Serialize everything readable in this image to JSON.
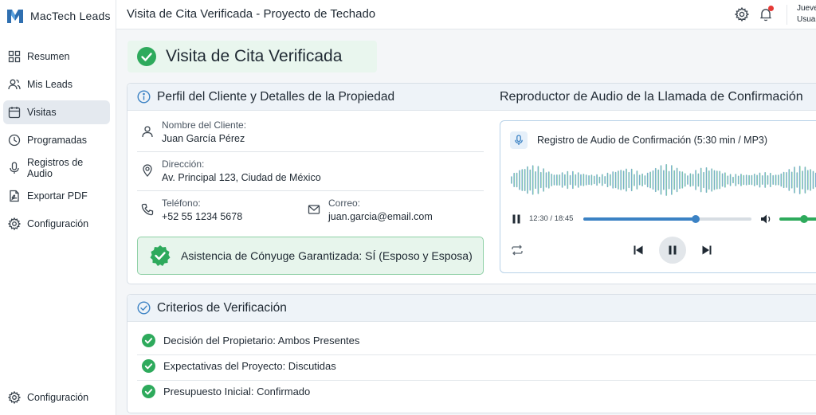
{
  "app": {
    "name": "MacTech Leads"
  },
  "sidebar": {
    "items": [
      {
        "label": "Resumen",
        "icon": "dashboard-icon"
      },
      {
        "label": "Mis Leads",
        "icon": "users-icon"
      },
      {
        "label": "Visitas",
        "icon": "calendar-icon",
        "active": true
      },
      {
        "label": "Programadas",
        "icon": "clock-icon"
      },
      {
        "label": "Registros de Audio",
        "icon": "microphone-icon"
      },
      {
        "label": "Exportar PDF",
        "icon": "pdf-file-icon"
      },
      {
        "label": "Configuración",
        "icon": "gear-icon"
      }
    ],
    "bottom_item": {
      "label": "Configuración",
      "icon": "gear-icon"
    }
  },
  "header": {
    "title": "Visita de Cita Verificada - Proyecto de Techado",
    "user_line1": "Jueves",
    "user_line2": "Usuario"
  },
  "banner": {
    "title": "Visita de Cita Verificada"
  },
  "profile": {
    "title": "Perfil del Cliente y Detalles de la Propiedad",
    "name_label": "Nombre del Cliente:",
    "name_value": "Juan García Pérez",
    "address_label": "Dirección:",
    "address_value": "Av. Principal 123, Ciudad de México",
    "phone_label": "Teléfono:",
    "phone_value": "+52 55 1234 5678",
    "email_label": "Correo:",
    "email_value": "juan.garcia@email.com",
    "spouse_text": "Asistencia de Cónyuge Garantizada: SÍ (Esposo y Esposa)"
  },
  "audio": {
    "title": "Reproductor de Audio de la Llamada de Confirmación",
    "file_label": "Registro de Audio de Confirmación (5:30 min / MP3)",
    "time_display": "12:30 / 18:45",
    "progress": 0.666,
    "volume": 0.55
  },
  "criteria": {
    "title": "Criterios de Verificación",
    "items": [
      "Decisión del Propietario: Ambos Presentes",
      "Expectativas del Proyecto: Discutidas",
      "Presupuesto Inicial: Confirmado"
    ]
  },
  "colors": {
    "accent": "#3b82c4",
    "success": "#2eaa5c",
    "notification": "#e53935"
  }
}
